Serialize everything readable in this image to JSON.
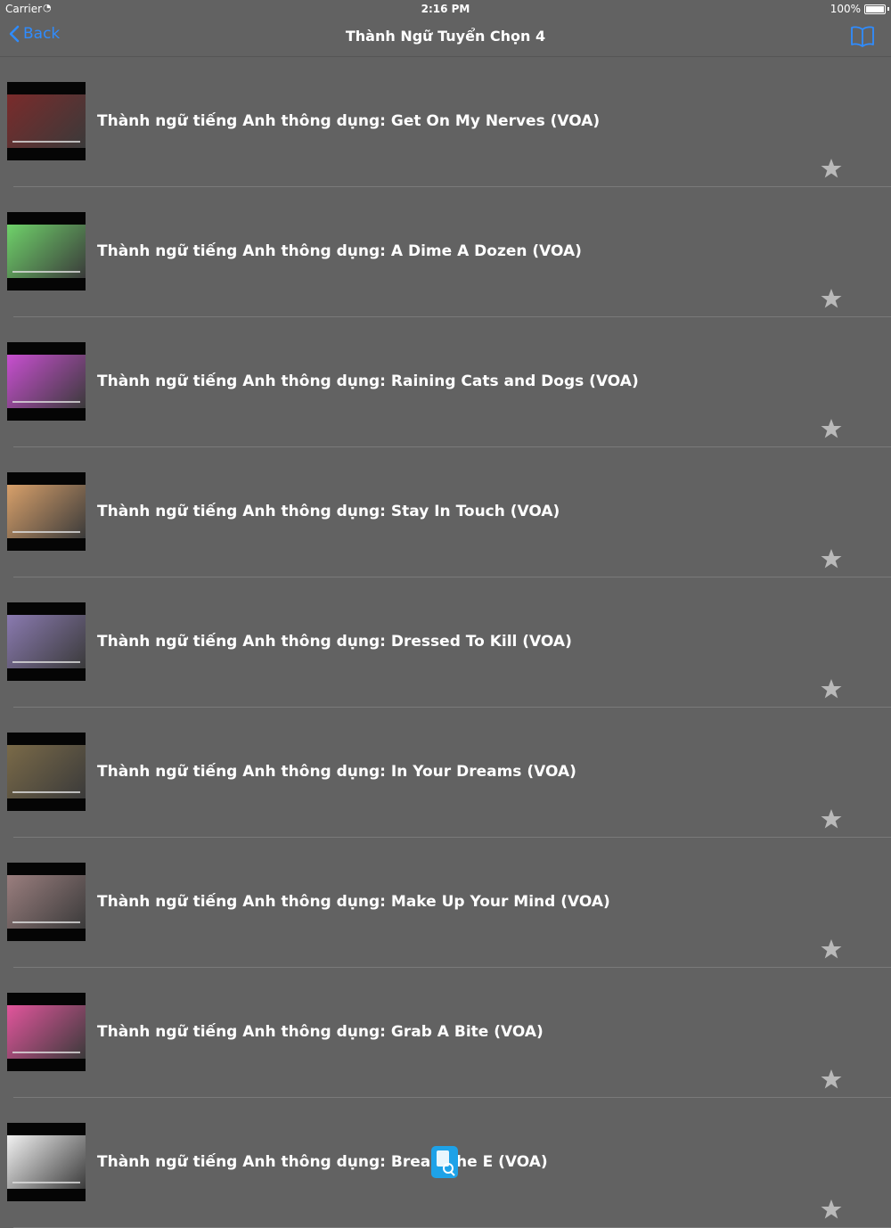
{
  "status_bar": {
    "carrier": "Carrier",
    "time": "2:16 PM",
    "battery": "100%"
  },
  "nav": {
    "back_label": "Back",
    "title": "Thành Ngữ Tuyển Chọn 4"
  },
  "colors": {
    "accent": "#2f8cff",
    "background": "#626262",
    "star": "#b9b9b9"
  },
  "items": [
    {
      "title": "Thành ngữ tiếng Anh thông dụng: Get On My Nerves (VOA)",
      "thumb_color": "#7a2b2b"
    },
    {
      "title": "Thành ngữ tiếng Anh thông dụng: A Dime A Dozen (VOA)",
      "thumb_color": "#6fd26a"
    },
    {
      "title": "Thành ngữ tiếng Anh thông dụng: Raining Cats and Dogs (VOA)",
      "thumb_color": "#c84fd0"
    },
    {
      "title": "Thành ngữ tiếng Anh thông dụng: Stay In Touch (VOA)",
      "thumb_color": "#d8a06a"
    },
    {
      "title": "Thành ngữ tiếng Anh thông dụng: Dressed To Kill (VOA)",
      "thumb_color": "#8a7ab0"
    },
    {
      "title": "Thành ngữ tiếng Anh thông dụng: In Your Dreams (VOA)",
      "thumb_color": "#7a6a48"
    },
    {
      "title": "Thành ngữ tiếng Anh thông dụng: Make Up Your Mind (VOA)",
      "thumb_color": "#9a7e7e"
    },
    {
      "title": "Thành ngữ tiếng Anh thông dụng: Grab A Bite (VOA)",
      "thumb_color": "#e2559c"
    },
    {
      "title": "Thành ngữ tiếng Anh thông dụng: Break The E   (VOA)",
      "thumb_color": "#f2f2f2"
    }
  ]
}
